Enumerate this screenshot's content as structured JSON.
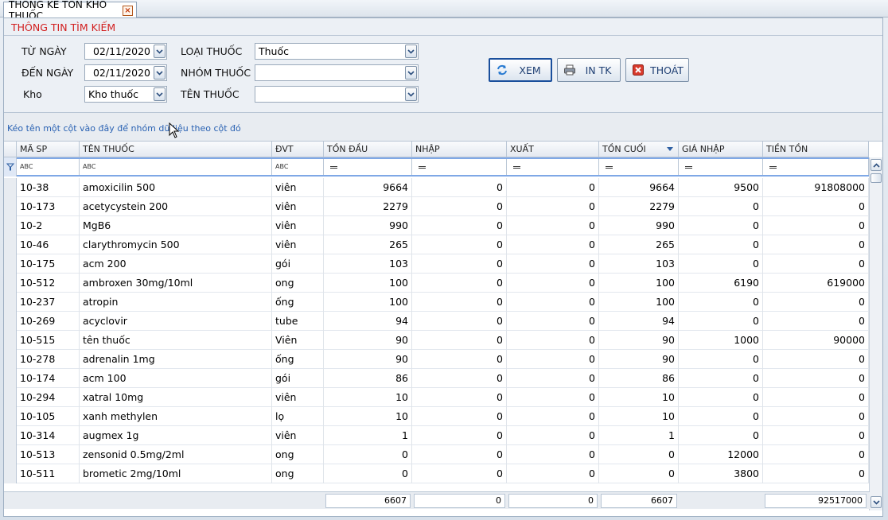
{
  "tab": {
    "title": "THỐNG KÊ TỒN KHO THUỐC",
    "close_symbol": "×"
  },
  "search": {
    "title": "THÔNG TIN TÌM KIẾM",
    "from_label": "TỪ NGÀY",
    "from_value": "02/11/2020",
    "to_label": "ĐẾN NGÀY",
    "to_value": "02/11/2020",
    "warehouse_label": "Kho",
    "warehouse_value": "Kho thuốc",
    "type_label": "LOẠI THUỐC",
    "type_value": "Thuốc",
    "group_label": "NHÓM THUỐC",
    "group_value": "",
    "name_label": "TÊN THUỐC",
    "name_value": ""
  },
  "buttons": {
    "view": "XEM",
    "print": "IN TK",
    "exit": "THOÁT"
  },
  "grid": {
    "group_hint": "Kéo tên một cột vào đây để nhóm dữ liệu theo cột đó",
    "columns": [
      "MÃ SP",
      "TÊN THUỐC",
      "ĐVT",
      "TỒN ĐẦU",
      "NHẬP",
      "XUẤT",
      "TỒN CUỐI",
      "GIÁ NHẬP",
      "TIỀN TỒN"
    ],
    "filter_text_icon": "ABC",
    "rows": [
      [
        "10-38",
        "amoxicilin 500",
        "viên",
        "9664",
        "0",
        "0",
        "9664",
        "9500",
        "91808000"
      ],
      [
        "10-173",
        "acetycystein 200",
        "viên",
        "2279",
        "0",
        "0",
        "2279",
        "0",
        "0"
      ],
      [
        "10-2",
        "MgB6",
        "viên",
        "990",
        "0",
        "0",
        "990",
        "0",
        "0"
      ],
      [
        "10-46",
        "clarythromycin 500",
        "viên",
        "265",
        "0",
        "0",
        "265",
        "0",
        "0"
      ],
      [
        "10-175",
        "acm 200",
        "gói",
        "103",
        "0",
        "0",
        "103",
        "0",
        "0"
      ],
      [
        "10-512",
        "ambroxen 30mg/10ml",
        "ong",
        "100",
        "0",
        "0",
        "100",
        "6190",
        "619000"
      ],
      [
        "10-237",
        "atropin",
        "ống",
        "100",
        "0",
        "0",
        "100",
        "0",
        "0"
      ],
      [
        "10-269",
        "acyclovir",
        "tube",
        "94",
        "0",
        "0",
        "94",
        "0",
        "0"
      ],
      [
        "10-515",
        "tên thuốc",
        "Viên",
        "90",
        "0",
        "0",
        "90",
        "1000",
        "90000"
      ],
      [
        "10-278",
        "adrenalin 1mg",
        "ống",
        "90",
        "0",
        "0",
        "90",
        "0",
        "0"
      ],
      [
        "10-174",
        "acm 100",
        "gói",
        "86",
        "0",
        "0",
        "86",
        "0",
        "0"
      ],
      [
        "10-294",
        "xatral 10mg",
        "viên",
        "10",
        "0",
        "0",
        "10",
        "0",
        "0"
      ],
      [
        "10-105",
        "xanh methylen",
        "lọ",
        "10",
        "0",
        "0",
        "10",
        "0",
        "0"
      ],
      [
        "10-314",
        "augmex 1g",
        "viên",
        "1",
        "0",
        "0",
        "1",
        "0",
        "0"
      ],
      [
        "10-513",
        "zensonid 0.5mg/2ml",
        "ong",
        "0",
        "0",
        "0",
        "0",
        "12000",
        "0"
      ],
      [
        "10-511",
        "brometic 2mg/10ml",
        "ong",
        "0",
        "0",
        "0",
        "0",
        "3800",
        "0"
      ]
    ],
    "totals": {
      "ton_dau": "6607",
      "nhap": "0",
      "xuat": "0",
      "ton_cuoi": "6607",
      "tien_ton": "92517000"
    }
  },
  "colors": {
    "title_red": "#d21f1f",
    "filter_row": "#7fa8e6",
    "button_text": "#1e3f73"
  }
}
